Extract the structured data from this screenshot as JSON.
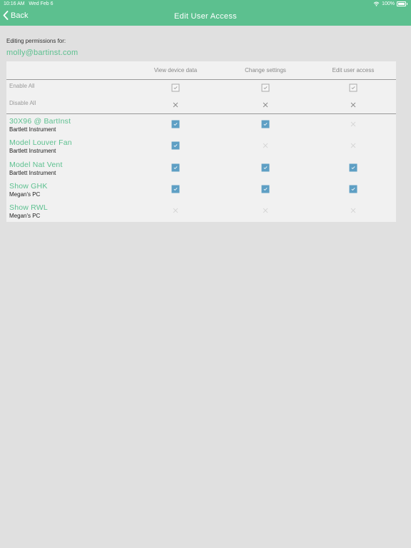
{
  "status_bar": {
    "time": "10:16 AM",
    "date": "Wed Feb 6",
    "battery": "100%"
  },
  "nav": {
    "back_label": "Back",
    "title": "Edit User Access"
  },
  "editing": {
    "label": "Editing permissions for:",
    "email": "molly@bartinst.com"
  },
  "columns": [
    "View device data",
    "Change settings",
    "Edit user access"
  ],
  "bulk": {
    "enable_label": "Enable All",
    "disable_label": "Disable All"
  },
  "devices": [
    {
      "name": "30X96 @ BartInst",
      "owner": "Bartlett Instrument",
      "perms": [
        true,
        true,
        false
      ]
    },
    {
      "name": "Model Louver Fan",
      "owner": "Bartlett Instrument",
      "perms": [
        true,
        false,
        false
      ]
    },
    {
      "name": "Model Nat Vent",
      "owner": "Bartlett Instrument",
      "perms": [
        true,
        true,
        true
      ]
    },
    {
      "name": "Show GHK",
      "owner": "Megan's PC",
      "perms": [
        true,
        true,
        true
      ]
    },
    {
      "name": "Show RWL",
      "owner": "Megan's PC",
      "perms": [
        false,
        false,
        false
      ]
    }
  ],
  "colors": {
    "accent": "#5cc08f",
    "checkbox": "#5e9fc4",
    "background": "#e0e0e0"
  }
}
